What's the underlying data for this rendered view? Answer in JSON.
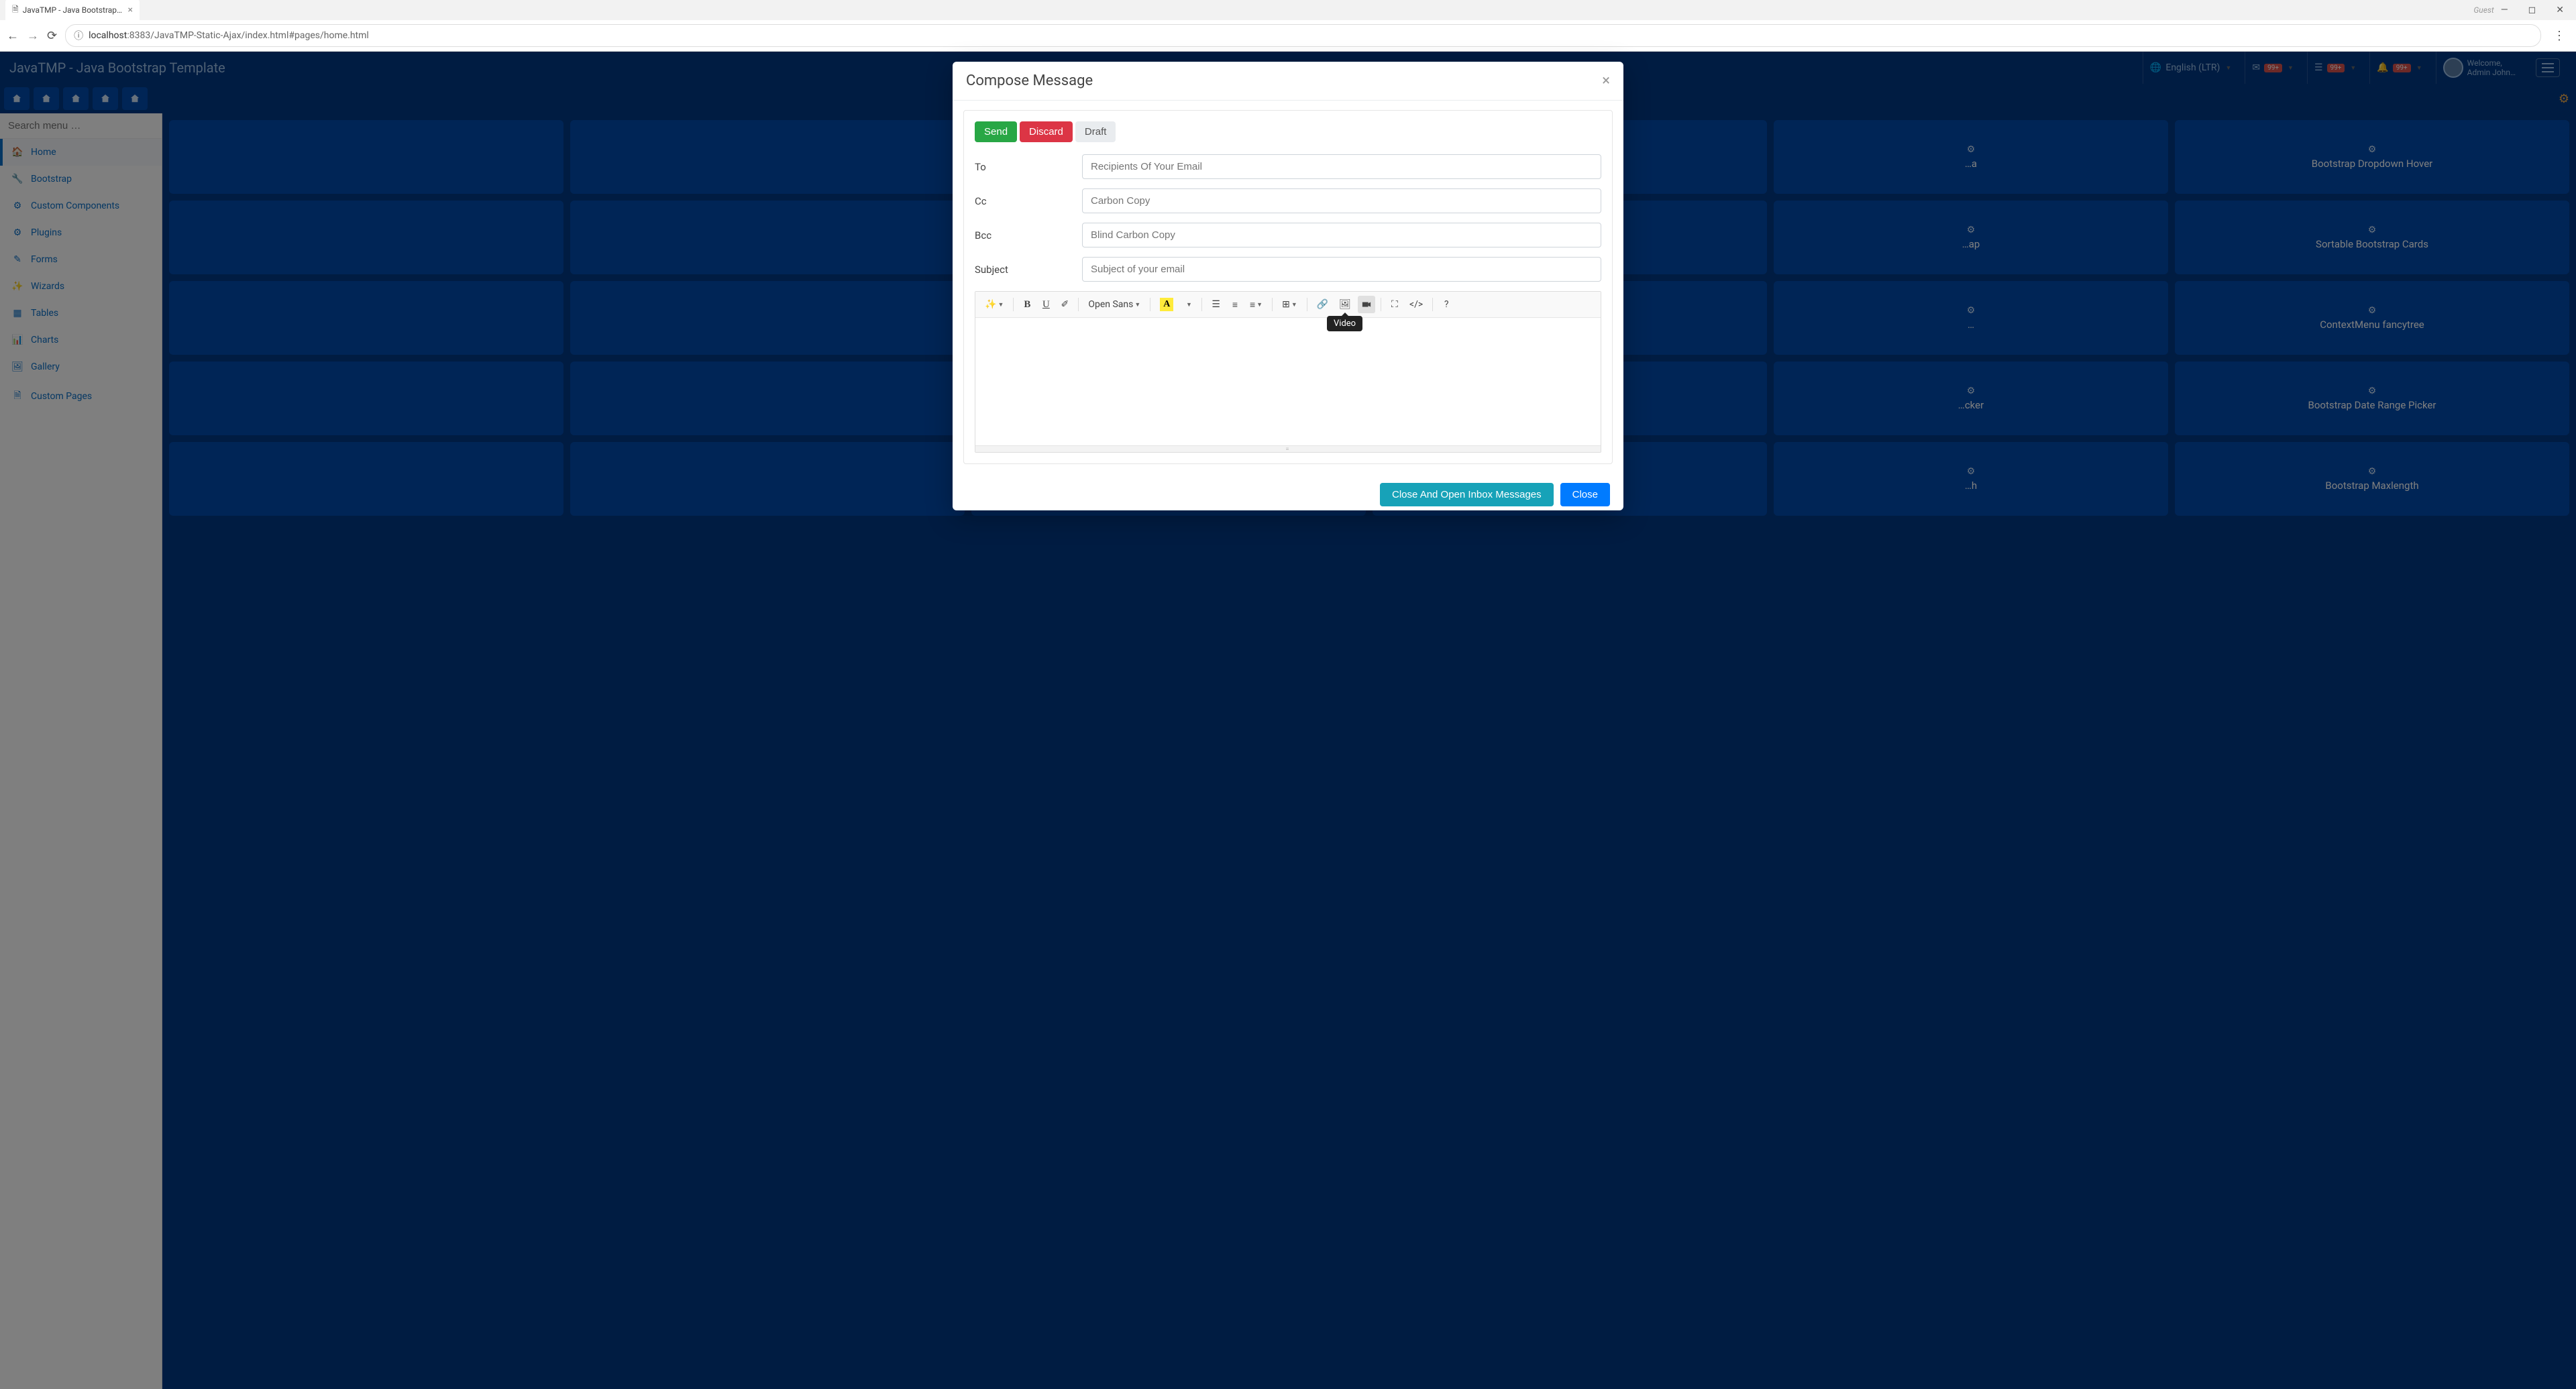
{
  "browser": {
    "tab_title": "JavaTMP - Java Bootstrap…",
    "guest": "Guest",
    "url_prefix": "localhost",
    "url_rest": ":8383/JavaTMP-Static-Ajax/index.html#pages/home.html"
  },
  "header": {
    "app_title": "JavaTMP - Java Bootstrap Template",
    "language": "English (LTR)",
    "badge": "99+",
    "welcome": "Welcome,",
    "username": "Admin John…"
  },
  "sidebar": {
    "search_placeholder": "Search menu …",
    "items": [
      {
        "icon": "home",
        "label": "Home"
      },
      {
        "icon": "wrench",
        "label": "Bootstrap"
      },
      {
        "icon": "cog",
        "label": "Custom Components"
      },
      {
        "icon": "cogs",
        "label": "Plugins"
      },
      {
        "icon": "edit",
        "label": "Forms"
      },
      {
        "icon": "magic",
        "label": "Wizards"
      },
      {
        "icon": "table",
        "label": "Tables"
      },
      {
        "icon": "chart",
        "label": "Charts"
      },
      {
        "icon": "image",
        "label": "Gallery"
      },
      {
        "icon": "file",
        "label": "Custom Pages"
      }
    ]
  },
  "cards": [
    "…a",
    "Bootstrap Dropdown Hover",
    "…ap",
    "Sortable Bootstrap Cards",
    "…",
    "ContextMenu fancytree",
    "…cker",
    "Bootstrap Date Range Picker",
    "…h",
    "Bootstrap Maxlength"
  ],
  "modal": {
    "title": "Compose Message",
    "buttons": {
      "send": "Send",
      "discard": "Discard",
      "draft": "Draft"
    },
    "fields": {
      "to": {
        "label": "To",
        "placeholder": "Recipients Of Your Email"
      },
      "cc": {
        "label": "Cc",
        "placeholder": "Carbon Copy"
      },
      "bcc": {
        "label": "Bcc",
        "placeholder": "Blind Carbon Copy"
      },
      "subject": {
        "label": "Subject",
        "placeholder": "Subject of your email"
      }
    },
    "toolbar": {
      "font": "Open Sans",
      "tooltip": "Video"
    },
    "footer": {
      "close_inbox": "Close And Open Inbox Messages",
      "close": "Close"
    }
  }
}
